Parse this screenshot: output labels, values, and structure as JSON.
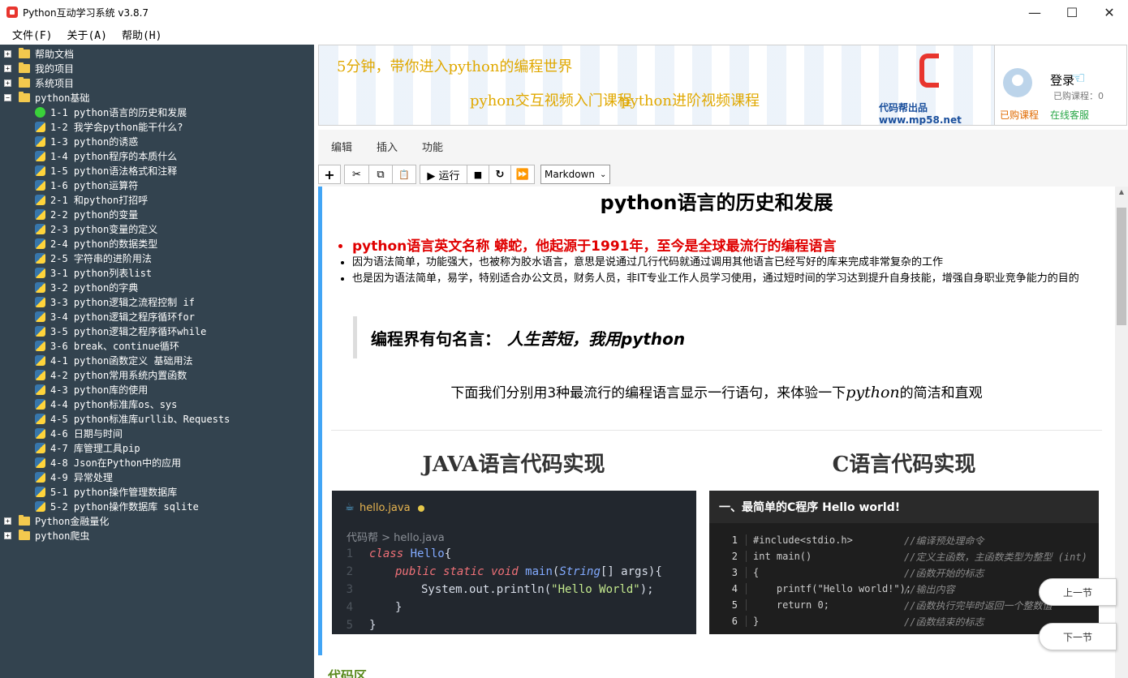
{
  "window": {
    "title": "Python互动学习系统 v3.8.7",
    "minimize": "—",
    "maximize": "☐",
    "close": "✕"
  },
  "menu": [
    "文件(F)",
    "关于(A)",
    "帮助(H)"
  ],
  "tree": {
    "top": [
      {
        "label": "帮助文档",
        "expanded": false
      },
      {
        "label": "我的项目",
        "expanded": false
      },
      {
        "label": "系统项目",
        "expanded": false
      },
      {
        "label": "python基础",
        "expanded": true
      }
    ],
    "children": [
      {
        "label": "1-1 python语言的历史和发展",
        "active": true
      },
      {
        "label": "1-2 我学会python能干什么?"
      },
      {
        "label": "1-3 python的诱惑"
      },
      {
        "label": "1-4 python程序的本质什么"
      },
      {
        "label": "1-5 python语法格式和注释"
      },
      {
        "label": "1-6 python运算符"
      },
      {
        "label": "2-1 和python打招呼"
      },
      {
        "label": "2-2 python的变量"
      },
      {
        "label": "2-3 python变量的定义"
      },
      {
        "label": "2-4 python的数据类型"
      },
      {
        "label": "2-5 字符串的进阶用法"
      },
      {
        "label": "3-1 python列表list"
      },
      {
        "label": "3-2 python的字典"
      },
      {
        "label": "3-3 python逻辑之流程控制 if"
      },
      {
        "label": "3-4 python逻辑之程序循环for"
      },
      {
        "label": "3-5 python逻辑之程序循环while"
      },
      {
        "label": "3-6 break、continue循环"
      },
      {
        "label": "4-1 python函数定义 基础用法"
      },
      {
        "label": "4-2 python常用系统内置函数"
      },
      {
        "label": "4-3 python库的使用"
      },
      {
        "label": "4-4 python标准库os、sys"
      },
      {
        "label": "4-5 python标准库urllib、Requests"
      },
      {
        "label": "4-6 日期与时间"
      },
      {
        "label": "4-7 库管理工具pip"
      },
      {
        "label": "4-8 Json在Python中的应用"
      },
      {
        "label": "4-9 异常处理"
      },
      {
        "label": "5-1 python操作管理数据库"
      },
      {
        "label": "5-2 python操作数据库 sqlite"
      }
    ],
    "bottom": [
      {
        "label": "Python金融量化",
        "expanded": false
      },
      {
        "label": "python爬虫",
        "expanded": false
      }
    ]
  },
  "banner": {
    "slogan": "5分钟，带你进入python的编程世界",
    "course1": "pyhon交互视频入门课程",
    "course2": "python进阶视频课程",
    "brand": "代码帮出品 www.mp58.net"
  },
  "user": {
    "login": "登录",
    "purchased_count": "已购课程：0",
    "purchased_link": "已购课程",
    "service_link": "在线客服"
  },
  "tabs": [
    "编辑",
    "插入",
    "功能"
  ],
  "toolbar": {
    "add": "+",
    "cut": "✂",
    "copy": "⧉",
    "paste": "📋",
    "run": "▶ 运行",
    "stop": "■",
    "restart": "↻",
    "run_all": "⏩",
    "mode": "Markdown"
  },
  "doc": {
    "title": "python语言的历史和发展",
    "bullets": [
      "python语言英文名称 蟒蛇，他起源于1991年，至今是全球最流行的编程语言",
      "因为语法简单，功能强大，也被称为胶水语言，意思是说通过几行代码就通过调用其他语言已经写好的库来完成非常复杂的工作",
      "也是因为语法简单，易学，特别适合办公文员，财务人员，非IT专业工作人员学习使用，通过短时间的学习达到提升自身技能，增强自身职业竞争能力的目的"
    ],
    "quote_prefix": "编程界有句名言：",
    "quote_main": "人生苦短，我用python",
    "intro_before": "下面我们分别用3种最流行的编程语言显示一行语句，来体验一下",
    "intro_py": "python",
    "intro_after": "的简洁和直观",
    "java_heading": "JAVA语言代码实现",
    "c_heading": "C语言代码实现",
    "java": {
      "tab": "hello.java",
      "crumb": "代码帮 > hello.java",
      "lines": [
        "1",
        "2",
        "3",
        "4",
        "5"
      ],
      "code": {
        "l1_kw": "class",
        "l1_name": "Hello",
        "l1_brace": " {",
        "l2_kw": "public static void",
        "l2_name": "main",
        "l2_type": "String",
        "l2_rest": "[] args){",
        "l3_call": "System.out.println(",
        "l3_str": "\"Hello World\"",
        "l3_end": ");",
        "l4": "}",
        "l5": "}"
      }
    },
    "c": {
      "header": "一、最简单的C程序 Hello world!",
      "lines": [
        {
          "n": "1",
          "code": "#include<stdio.h>",
          "comment": "//编译预处理命令"
        },
        {
          "n": "2",
          "code": "int main()",
          "comment": "//定义主函数，主函数类型为整型 (int)"
        },
        {
          "n": "3",
          "code": "{",
          "comment": "//函数开始的标志"
        },
        {
          "n": "4",
          "code": "    printf(\"Hello world!\");",
          "comment": "//输出内容"
        },
        {
          "n": "5",
          "code": "    return 0;",
          "comment": "//函数执行完毕时返回一个整数值"
        },
        {
          "n": "6",
          "code": "}",
          "comment": "//函数结束的标志"
        }
      ]
    },
    "code_area_label": "代码区"
  },
  "nav": {
    "prev": "上一节",
    "next": "下一节"
  }
}
